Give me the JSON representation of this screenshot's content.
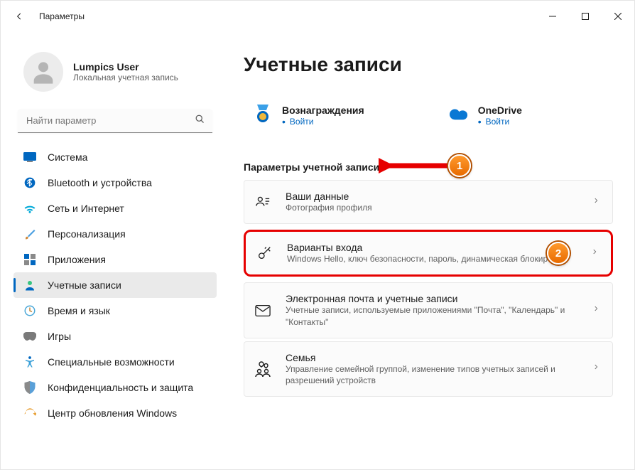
{
  "window": {
    "title": "Параметры"
  },
  "profile": {
    "name": "Lumpics User",
    "sub": "Локальная учетная запись"
  },
  "search": {
    "placeholder": "Найти параметр"
  },
  "sidebar": {
    "items": [
      {
        "label": "Система"
      },
      {
        "label": "Bluetooth и устройства"
      },
      {
        "label": "Сеть и Интернет"
      },
      {
        "label": "Персонализация"
      },
      {
        "label": "Приложения"
      },
      {
        "label": "Учетные записи"
      },
      {
        "label": "Время и язык"
      },
      {
        "label": "Игры"
      },
      {
        "label": "Специальные возможности"
      },
      {
        "label": "Конфиденциальность и защита"
      },
      {
        "label": "Центр обновления Windows"
      }
    ]
  },
  "main": {
    "title": "Учетные записи",
    "top": {
      "rewards": {
        "title": "Вознаграждения",
        "action": "Войти"
      },
      "onedrive": {
        "title": "OneDrive",
        "action": "Войти"
      }
    },
    "section_head": "Параметры учетной записи",
    "cards": {
      "your_info": {
        "title": "Ваши данные",
        "sub": "Фотография профиля"
      },
      "signin": {
        "title": "Варианты входа",
        "sub": "Windows Hello, ключ безопасности, пароль, динамическая блокировка"
      },
      "email": {
        "title": "Электронная почта и учетные записи",
        "sub": "Учетные записи, используемые приложениями \"Почта\", \"Календарь\" и \"Контакты\""
      },
      "family": {
        "title": "Семья",
        "sub": "Управление семейной группой, изменение типов учетных записей и разрешений устройств"
      }
    }
  },
  "annotations": {
    "one": "1",
    "two": "2"
  }
}
